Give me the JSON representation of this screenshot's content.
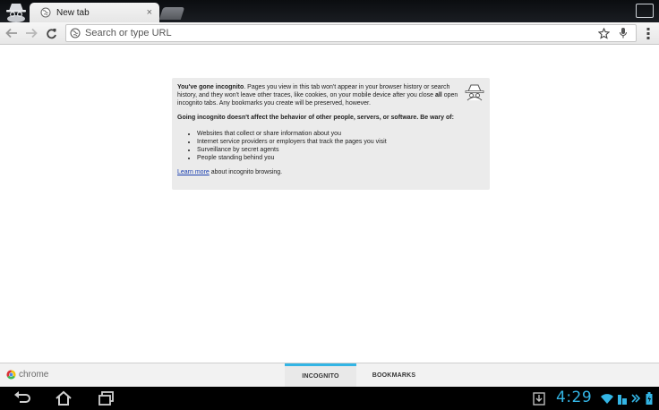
{
  "tabstrip": {
    "active_tab": {
      "title": "New tab",
      "close_glyph": "×"
    }
  },
  "omnibox": {
    "placeholder": "Search or type URL"
  },
  "incognito_card": {
    "intro_bold": "You've gone incognito",
    "intro_text_1": ". Pages you view in this tab won't appear in your browser history or search history, and they won't leave other traces, like cookies, on your mobile device after you close ",
    "intro_bold_2": "all",
    "intro_text_2": " open incognito tabs. Any bookmarks you create will be preserved, however.",
    "warning": "Going incognito doesn't affect the behavior of other people, servers, or software. Be wary of:",
    "items": [
      "Websites that collect or share information about you",
      "Internet service providers or employers that track the pages you visit",
      "Surveillance by secret agents",
      "People standing behind you"
    ],
    "learn_more_link": "Learn more",
    "learn_more_suffix": " about incognito browsing."
  },
  "bottombar": {
    "brand": "chrome",
    "tabs": [
      {
        "label": "INCOGNITO",
        "selected": true
      },
      {
        "label": "BOOKMARKS",
        "selected": false
      }
    ]
  },
  "status": {
    "time": "4:29"
  },
  "colors": {
    "accent": "#33b5e5",
    "link": "#1a3fb0"
  }
}
